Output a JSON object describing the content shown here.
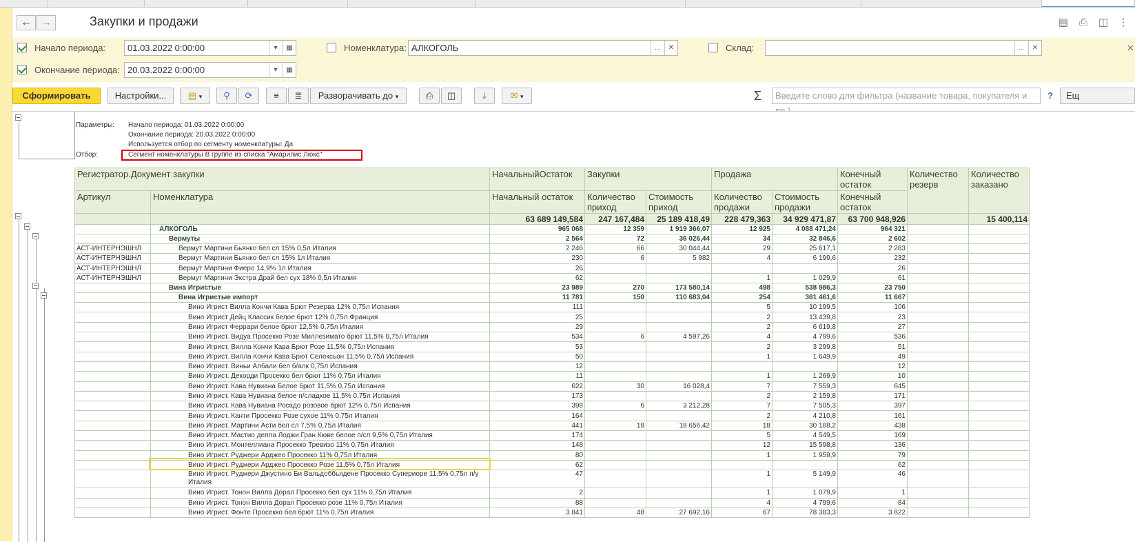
{
  "tabs": [
    "",
    "",
    "",
    "",
    "",
    "",
    "",
    "",
    "",
    "",
    ""
  ],
  "window": {
    "title": "Закупки и продажи",
    "back_label": "🡐",
    "forward_label": "🡒"
  },
  "params": {
    "period_start_label": "Начало периода:",
    "period_start_value": "01.03.2022  0:00:00",
    "period_end_label": "Окончание периода:",
    "period_end_value": "20.03.2022  0:00:00",
    "nomenclature_label": "Номенклатура:",
    "nomenclature_value": "АЛКОГОЛЬ",
    "warehouse_label": "Склад:",
    "warehouse_value": ""
  },
  "toolbar": {
    "generate_label": "Сформировать",
    "settings_label": "Настройки...",
    "expand_label": "Разворачивать до",
    "filter_placeholder": "Введите слово для фильтра (название товара, покупателя и пр.)",
    "help_label": "?",
    "more_label": "Ещ"
  },
  "report": {
    "params_caption": "Параметры:",
    "params_lines": [
      "Начало периода: 01.03.2022 0:00:00",
      "Окончание периода: 20.03.2022 0:00:00",
      "Используется отбор по сегменту номенклатуры: Да"
    ],
    "filter_caption": "Отбор:",
    "filter_text": "Сегмент номенклатуры В группе из списка \"Амарилис Люкс\"",
    "headers": {
      "registrar": "Регистратор.Документ закупки",
      "start_balance_group": "НачальныйОстаток",
      "purchases_group": "Закупки",
      "sales_group": "Продажа",
      "end_balance": "Конечный остаток",
      "reserve_qty": "Количество резерв",
      "ordered_qty": "Количество заказано",
      "article": "Артикул",
      "nomenclature": "Номенклатура",
      "start_balance": "Начальный остаток",
      "qty_in": "Количество приход",
      "cost_in": "Стоимость приход",
      "qty_sold": "Количество продажи",
      "cost_sold": "Стоимость продажи",
      "end_balance2": "Конечный остаток"
    },
    "total": {
      "start": "63 689 149,584",
      "qty_in": "247 167,484",
      "cost_in": "25 189 418,49",
      "qty_sold": "228 479,363",
      "cost_sold": "34 929 471,87",
      "end": "63 700 948,926",
      "reserve": "",
      "ordered": "15 400,114"
    },
    "rows": [
      {
        "type": "grp",
        "lvl": 1,
        "art": "",
        "name": "АЛКОГОЛЬ",
        "start": "965 068",
        "qin": "12 359",
        "cin": "1 919 366,07",
        "qs": "12 925",
        "cs": "4 088 471,24",
        "end": "964 321"
      },
      {
        "type": "grp",
        "lvl": 2,
        "art": "",
        "name": "Вермуты",
        "start": "2 564",
        "qin": "72",
        "cin": "36 026,44",
        "qs": "34",
        "cs": "32 846,6",
        "end": "2 602"
      },
      {
        "type": "item",
        "lvl": 3,
        "art": "АСТ-ИНТЕРНЭШНЛ",
        "name": "Вермут Мартини Бьянко бел сл 15% 0,5л Италия",
        "start": "2 246",
        "qin": "66",
        "cin": "30 044,44",
        "qs": "29",
        "cs": "25 617,1",
        "end": "2 283"
      },
      {
        "type": "item",
        "lvl": 3,
        "art": "АСТ-ИНТЕРНЭШНЛ",
        "name": "Вермут Мартини Бьянко бел сл 15% 1л Италия",
        "start": "230",
        "qin": "6",
        "cin": "5 982",
        "qs": "4",
        "cs": "6 199,6",
        "end": "232"
      },
      {
        "type": "item",
        "lvl": 3,
        "art": "АСТ-ИНТЕРНЭШНЛ",
        "name": "Вермут Мартини Фиеро 14,9% 1л Италия",
        "start": "26",
        "qin": "",
        "cin": "",
        "qs": "",
        "cs": "",
        "end": "26"
      },
      {
        "type": "item",
        "lvl": 3,
        "art": "АСТ-ИНТЕРНЭШНЛ",
        "name": "Вермут Мартини Экстра Драй бел сух 18% 0,5л Италия",
        "start": "62",
        "qin": "",
        "cin": "",
        "qs": "1",
        "cs": "1 029,9",
        "end": "61"
      },
      {
        "type": "grp",
        "lvl": 2,
        "art": "",
        "name": "Вина Игристые",
        "start": "23 989",
        "qin": "270",
        "cin": "173 580,14",
        "qs": "498",
        "cs": "538 986,3",
        "end": "23 750"
      },
      {
        "type": "grp",
        "lvl": 3,
        "art": "",
        "name": "Вина Игристые импорт",
        "start": "11 781",
        "qin": "150",
        "cin": "110 683,04",
        "qs": "254",
        "cs": "361 461,6",
        "end": "11 667"
      },
      {
        "type": "item",
        "lvl": 4,
        "art": "",
        "name": "Вино Игрист Вилла Кончи Кава Брют Резерва 12% 0,75л Испания",
        "start": "111",
        "qin": "",
        "cin": "",
        "qs": "5",
        "cs": "10 199,5",
        "end": "106"
      },
      {
        "type": "item",
        "lvl": 4,
        "art": "",
        "name": "Вино Игрист Дейц Классик белое брют 12% 0,75л Франция",
        "start": "25",
        "qin": "",
        "cin": "",
        "qs": "2",
        "cs": "13 439,8",
        "end": "23"
      },
      {
        "type": "item",
        "lvl": 4,
        "art": "",
        "name": "Вино Игрист Феррари белое брют 12,5% 0,75л Италия",
        "start": "29",
        "qin": "",
        "cin": "",
        "qs": "2",
        "cs": "6 619,8",
        "end": "27"
      },
      {
        "type": "item",
        "lvl": 4,
        "art": "",
        "name": "Вино Игрист. Видуа Просекко Розе Миллезимато брют 11,5% 0,75л Италия",
        "start": "534",
        "qin": "6",
        "cin": "4 597,26",
        "qs": "4",
        "cs": "4 799,6",
        "end": "536"
      },
      {
        "type": "item",
        "lvl": 4,
        "art": "",
        "name": "Вино Игрист. Вилла Кончи Кава Брют Розе 11,5% 0,75л Испания",
        "start": "53",
        "qin": "",
        "cin": "",
        "qs": "2",
        "cs": "3 299,8",
        "end": "51"
      },
      {
        "type": "item",
        "lvl": 4,
        "art": "",
        "name": "Вино Игрист. Вилла Кончи Кава Брют Селексьон 11,5% 0,75л Испания",
        "start": "50",
        "qin": "",
        "cin": "",
        "qs": "1",
        "cs": "1 649,9",
        "end": "49"
      },
      {
        "type": "item",
        "lvl": 4,
        "art": "",
        "name": "Вино Игрист. Виньи Албали бел б/алк 0,75л Испания",
        "start": "12",
        "qin": "",
        "cin": "",
        "qs": "",
        "cs": "",
        "end": "12"
      },
      {
        "type": "item",
        "lvl": 4,
        "art": "",
        "name": "Вино Игрист. Декорди Просекко бел брют 11% 0,75л Италия",
        "start": "11",
        "qin": "",
        "cin": "",
        "qs": "1",
        "cs": "1 269,9",
        "end": "10"
      },
      {
        "type": "item",
        "lvl": 4,
        "art": "",
        "name": "Вино Игрист. Кава Нувиана Белое брют 11,5% 0,75л Испания",
        "start": "622",
        "qin": "30",
        "cin": "16 028,4",
        "qs": "7",
        "cs": "7 559,3",
        "end": "645"
      },
      {
        "type": "item",
        "lvl": 4,
        "art": "",
        "name": "Вино Игрист. Кава Нувиана белое п/сладкое 11,5% 0,75л Испания",
        "start": "173",
        "qin": "",
        "cin": "",
        "qs": "2",
        "cs": "2 159,8",
        "end": "171"
      },
      {
        "type": "item",
        "lvl": 4,
        "art": "",
        "name": "Вино Игрист. Кава Нувиана Росадо розовое брют 12% 0,75л Испания",
        "start": "398",
        "qin": "6",
        "cin": "3 212,28",
        "qs": "7",
        "cs": "7 505,3",
        "end": "397"
      },
      {
        "type": "item",
        "lvl": 4,
        "art": "",
        "name": "Вино Игрист. Канти Просекко Розе сухое 11% 0,75л Италия",
        "start": "164",
        "qin": "",
        "cin": "",
        "qs": "2",
        "cs": "4 210,8",
        "end": "161"
      },
      {
        "type": "item",
        "lvl": 4,
        "art": "",
        "name": "Вино Игрист. Мартини Асти бел сл 7,5% 0,75л Италия",
        "start": "441",
        "qin": "18",
        "cin": "18 656,42",
        "qs": "18",
        "cs": "30 188,2",
        "end": "438"
      },
      {
        "type": "item",
        "lvl": 4,
        "art": "",
        "name": "Вино Игрист. Мастио делла Лоджи Гран Кюве белое п/сл 9,5% 0,75л Италия",
        "start": "174",
        "qin": "",
        "cin": "",
        "qs": "5",
        "cs": "4 549,5",
        "end": "169"
      },
      {
        "type": "item",
        "lvl": 4,
        "art": "",
        "name": "Вино Игрист. Монтеллиана Просекко Тревизо 11% 0,75л Италия",
        "start": "148",
        "qin": "",
        "cin": "",
        "qs": "12",
        "cs": "15 598,8",
        "end": "136"
      },
      {
        "type": "item",
        "lvl": 4,
        "art": "",
        "name": "Вино Игрист. Руджери Арджео Просекко 11% 0,75л Италия",
        "start": "80",
        "qin": "",
        "cin": "",
        "qs": "1",
        "cs": "1 959,9",
        "end": "79"
      },
      {
        "type": "item",
        "lvl": 4,
        "art": "",
        "name": "Вино Игрист. Руджери Арджео Просекко Розе 11,5% 0,75л Италия",
        "start": "62",
        "qin": "",
        "cin": "",
        "qs": "",
        "cs": "",
        "end": "62"
      },
      {
        "type": "item2",
        "lvl": 4,
        "art": "",
        "name": "Вино Игрист. Руджери Джустино Би Вальдоббьядене Просекко Супериоре  11,5% 0,75л п/у Италия",
        "start": "47",
        "qin": "",
        "cin": "",
        "qs": "1",
        "cs": "5 149,9",
        "end": "46"
      },
      {
        "type": "item",
        "lvl": 4,
        "art": "",
        "name": "Вино Игрист. Тонон Вилла Дорал Просекко бел сух 11% 0,75л Италия",
        "start": "2",
        "qin": "",
        "cin": "",
        "qs": "1",
        "cs": "1 079,9",
        "end": "1"
      },
      {
        "type": "item",
        "lvl": 4,
        "art": "",
        "name": "Вино Игрист. Тонон Вилла Дорал Просекко розе 11% 0,75л Италия",
        "start": "88",
        "qin": "",
        "cin": "",
        "qs": "4",
        "cs": "4 799,6",
        "end": "84"
      },
      {
        "type": "item",
        "lvl": 4,
        "art": "",
        "name": "Вино Игрист. Фонте Просекко бел брют 11% 0,75л Италия",
        "start": "3 841",
        "qin": "48",
        "cin": "27 692,16",
        "qs": "67",
        "cs": "78 383,3",
        "end": "3 822"
      }
    ]
  },
  "colors": {
    "accent_yellow": "#fbd935",
    "param_bg": "#fbf6d6",
    "header_bg": "#e7eed9",
    "filter_highlight": "#d9000f",
    "row_highlight": "#f2d23c"
  }
}
